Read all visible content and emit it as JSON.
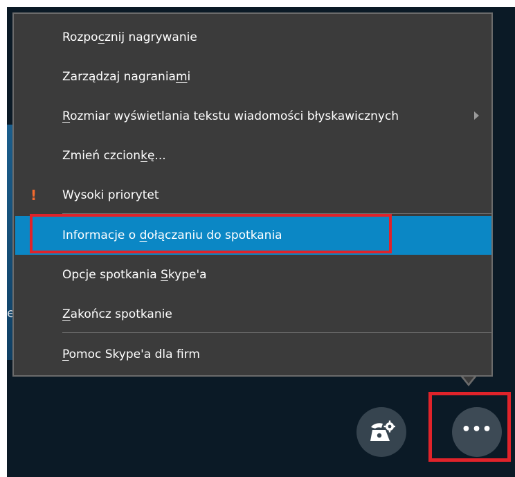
{
  "menu": {
    "items": [
      {
        "pre": "Rozpo",
        "key": "c",
        "post": "znij nagrywanie"
      },
      {
        "pre": "Zarządzaj nagrania",
        "key": "m",
        "post": "i"
      },
      {
        "pre": "",
        "key": "R",
        "post": "ozmiar wyświetlania tekstu wiadomości błyskawicznych"
      },
      {
        "pre": "Zmień czcion",
        "key": "k",
        "post": "ę..."
      },
      {
        "pre": "Wysoki priorytet",
        "key": "",
        "post": ""
      },
      {
        "pre": "Informacje o ",
        "key": "d",
        "post": "ołączaniu do spotkania"
      },
      {
        "pre": "Opcje spotkania ",
        "key": "S",
        "post": "kype'a"
      },
      {
        "pre": "",
        "key": "Z",
        "post": "akończ spotkanie"
      },
      {
        "pre": "",
        "key": "P",
        "post": "omoc Skype'a dla firm"
      }
    ],
    "priority_marker": "!",
    "selected_index": 5
  },
  "controls": {
    "more_label": "•••"
  },
  "background": {
    "partial_letter": "e"
  },
  "colors": {
    "menu_bg": "#3b3b3b",
    "highlight": "#0b87c5",
    "annotation": "#e0232a",
    "priority": "#f26a2e"
  },
  "icons": {
    "submenu": "chevron-right-icon",
    "priority": "exclamation-icon",
    "call_controls": "phone-gear-icon",
    "more": "more-options-icon"
  }
}
